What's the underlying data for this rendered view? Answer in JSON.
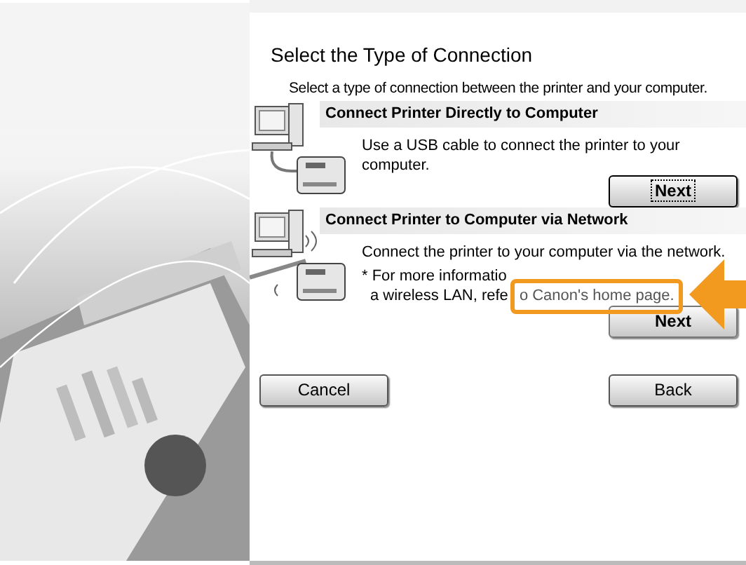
{
  "title": "Select the Type of Connection",
  "subtitle": "Select a type of connection between the printer and your computer.",
  "options": [
    {
      "kind": "direct",
      "heading": "Connect Printer Directly to Computer",
      "description": "Use a USB cable to connect the printer to your computer.",
      "button": {
        "label": "Next",
        "focused": true
      }
    },
    {
      "kind": "network",
      "heading": "Connect Printer to Computer via Network",
      "description": "Connect the printer to your computer via the network.",
      "note_lines": [
        "* For more informatio",
        "a wireless LAN, refe"
      ],
      "link": "o Canon's home page.",
      "button": {
        "label": "Next",
        "focused": false
      }
    }
  ],
  "footer_buttons": [
    {
      "label": "Cancel"
    },
    {
      "label": "Back"
    }
  ]
}
